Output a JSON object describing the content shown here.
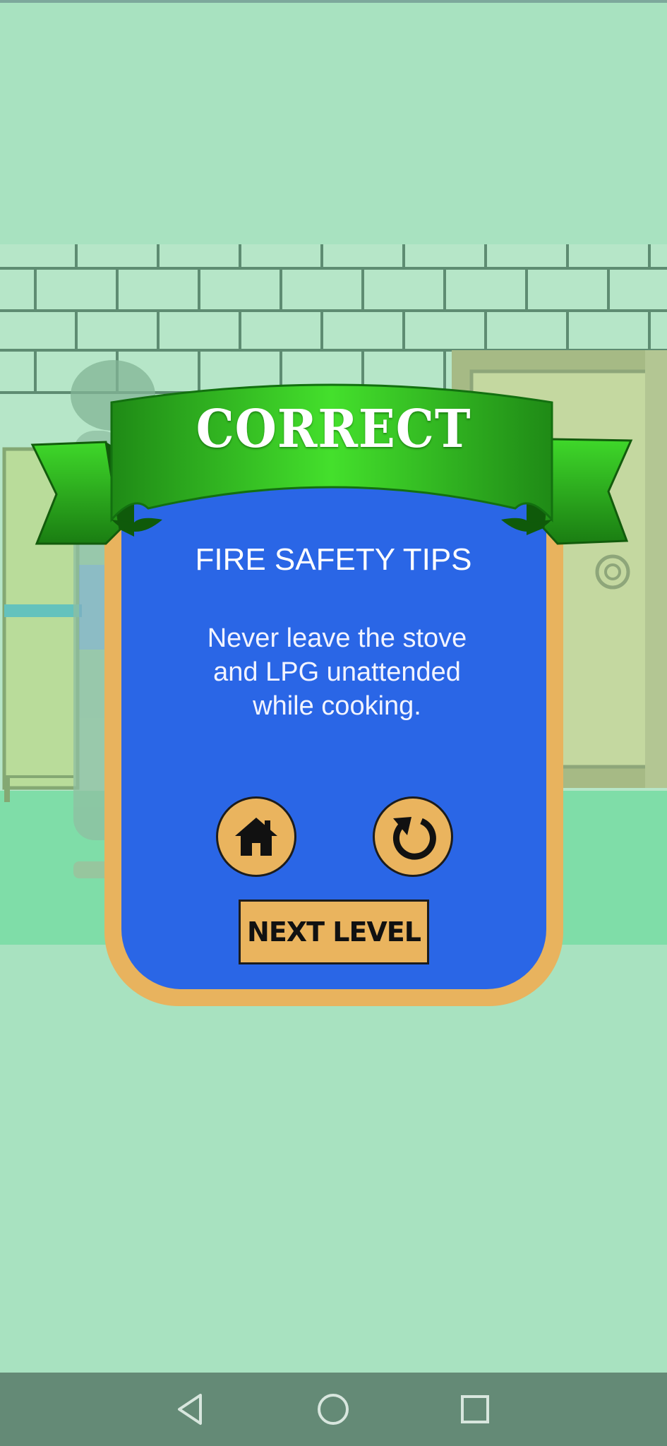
{
  "banner": {
    "title": "CORRECT"
  },
  "popup": {
    "heading": "FIRE SAFETY TIPS",
    "tip": "Never leave the stove and LPG unattended while cooking.",
    "next_label": "NEXT LEVEL"
  },
  "icons": {
    "home": "home-icon",
    "replay": "replay-icon",
    "nav_back": "back-triangle-icon",
    "nav_home": "home-circle-icon",
    "nav_recent": "recents-square-icon"
  },
  "colors": {
    "background": "#a8e2c0",
    "popup_panel": "#2a66e6",
    "popup_frame": "#e8b35e",
    "button": "#eab45e",
    "ribbon": "#34b41c",
    "navbar": "#648a76"
  }
}
